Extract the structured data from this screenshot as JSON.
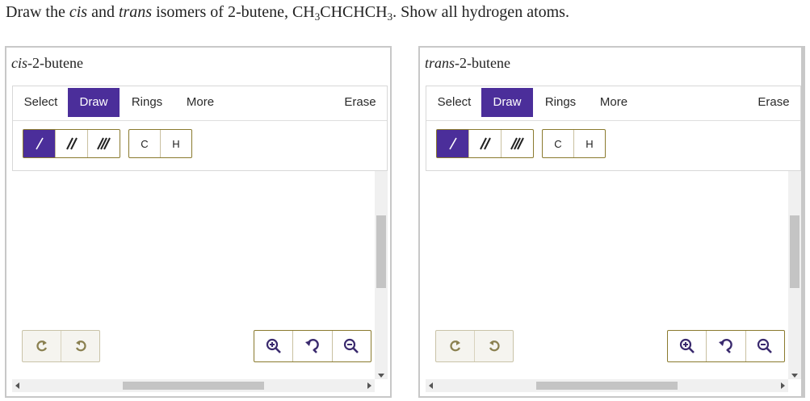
{
  "question": {
    "prefix": "Draw the ",
    "cis": "cis",
    "and": " and ",
    "trans": "trans",
    "mid": " isomers of 2-butene, CH",
    "sub1": "3",
    "mid2": "CHCHCH",
    "sub2": "3",
    "suffix": ". Show all hydrogen atoms."
  },
  "panels": [
    {
      "title_italic": "cis",
      "title_rest": "-2-butene",
      "tabs": [
        "Select",
        "Draw",
        "Rings",
        "More",
        "Erase"
      ],
      "active_tab": "Draw",
      "atoms": [
        "C",
        "H"
      ]
    },
    {
      "title_italic": "trans",
      "title_rest": "-2-butene",
      "tabs": [
        "Select",
        "Draw",
        "Rings",
        "More",
        "Erase"
      ],
      "active_tab": "Draw",
      "atoms": [
        "C",
        "H"
      ]
    }
  ],
  "bond_buttons": [
    "single-bond",
    "double-bond",
    "triple-bond"
  ],
  "icons": {
    "undo": "undo-icon",
    "redo": "redo-icon",
    "zoom_in": "zoom-in-icon",
    "zoom_reset": "zoom-reset-icon",
    "zoom_out": "zoom-out-icon"
  },
  "colors": {
    "accent": "#4b2e9a",
    "group_border": "#8a7a2e",
    "panel_border": "#c8c8c8"
  }
}
